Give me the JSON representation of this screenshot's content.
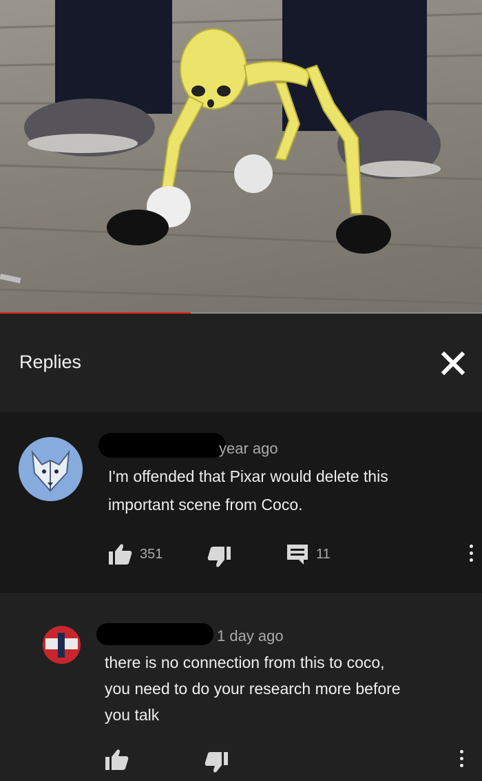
{
  "player": {
    "progress_fraction": 0.395,
    "colors": {
      "played": "#e62117",
      "unplayed": "#8d8d8d"
    }
  },
  "replies_panel": {
    "title": "Replies",
    "close_icon": "close-icon"
  },
  "comments": [
    {
      "timestamp": "year ago",
      "lines": [
        "I'm offended that Pixar would delete this",
        "important scene from Coco."
      ],
      "like_count": "351",
      "reply_count": "11",
      "icons": [
        "thumbs-up-icon",
        "thumbs-down-icon",
        "reply-icon",
        "more-vert-icon"
      ]
    },
    {
      "timestamp": "1 day ago",
      "lines": [
        "there is no connection from this to coco,",
        "you need to do your research more before",
        "you talk"
      ],
      "icons": [
        "thumbs-up-icon",
        "thumbs-down-icon",
        "more-vert-icon"
      ]
    }
  ],
  "colors": {
    "panel_background": "#212121",
    "parent_comment_background": "#181818",
    "secondary_text": "#aaaaaa"
  }
}
